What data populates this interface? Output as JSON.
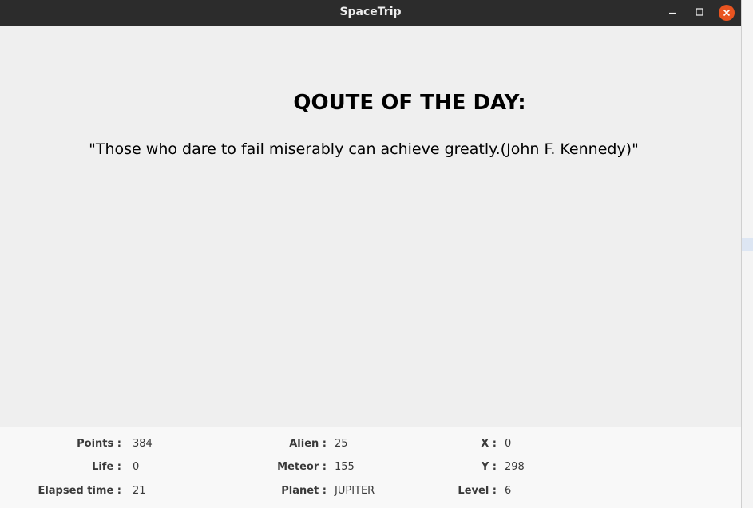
{
  "window": {
    "title": "SpaceTrip",
    "controls": {
      "minimize_icon": "minimize-icon",
      "maximize_icon": "maximize-icon",
      "close_icon": "close-icon",
      "close_color": "#e95420"
    }
  },
  "quote": {
    "heading": "QOUTE OF THE DAY:",
    "text": "\"Those who dare to fail miserably can achieve greatly.(John F. Kennedy)\""
  },
  "stats": {
    "points_label": "Points :",
    "points_value": "384",
    "life_label": "Life :",
    "life_value": "0",
    "elapsed_label": "Elapsed time :",
    "elapsed_value": "21",
    "alien_label": "Alien :",
    "alien_value": "25",
    "meteor_label": "Meteor :",
    "meteor_value": "155",
    "planet_label": "Planet :",
    "planet_value": "JUPITER",
    "x_label": "X :",
    "x_value": "0",
    "y_label": "Y :",
    "y_value": "298",
    "level_label": "Level :",
    "level_value": "6"
  }
}
